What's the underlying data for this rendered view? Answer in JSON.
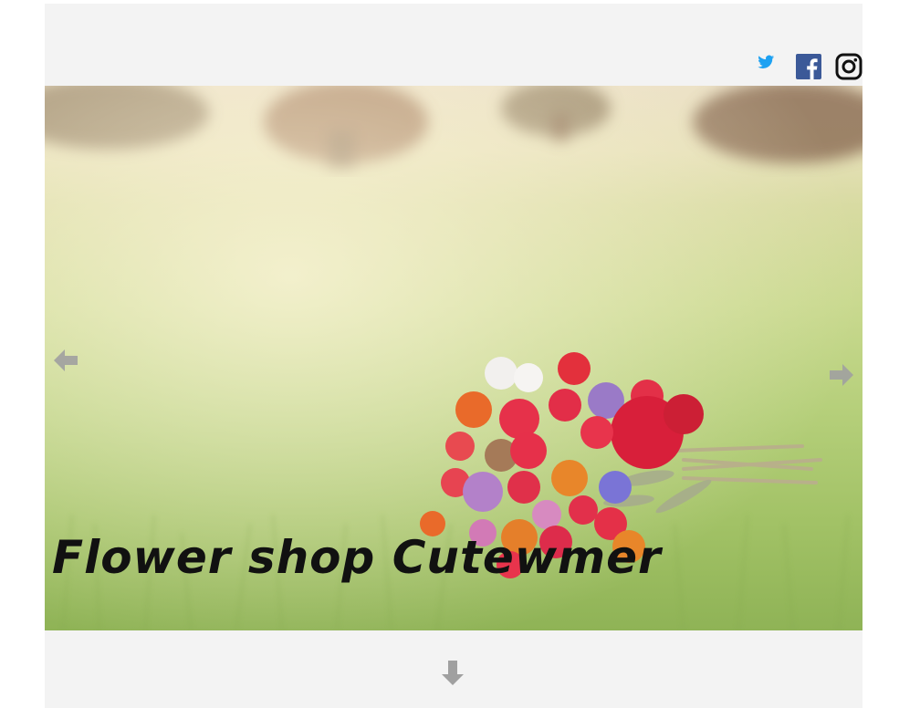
{
  "header": {
    "social": [
      {
        "name": "twitter",
        "icon": "twitter-icon",
        "color": "#1da1f2"
      },
      {
        "name": "facebook",
        "icon": "facebook-icon",
        "color": "#3b5998"
      },
      {
        "name": "instagram",
        "icon": "instagram-icon",
        "color": "#111111"
      }
    ]
  },
  "hero": {
    "title": "Flower shop Cutewmer",
    "image": "bouquet-on-grass",
    "prev_icon": "arrow-left-icon",
    "next_icon": "arrow-right-icon"
  },
  "scroll": {
    "icon": "arrow-down-icon"
  },
  "colors": {
    "page_bg": "#f3f3f3",
    "arrow": "#a0a0a0"
  }
}
